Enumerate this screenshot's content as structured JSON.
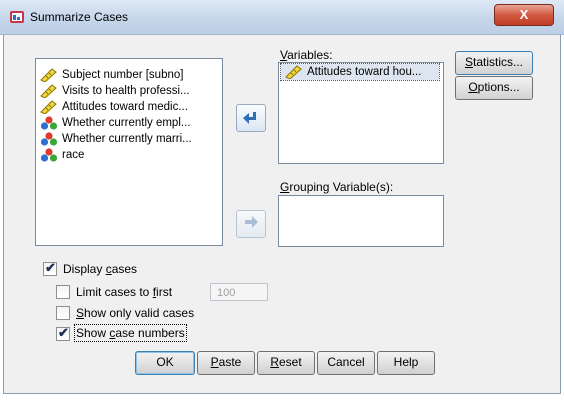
{
  "window": {
    "title": "Summarize Cases",
    "close_label": "X"
  },
  "source_list": {
    "items": [
      {
        "label": "Subject number [subno]",
        "icon": "ruler-icon"
      },
      {
        "label": "Visits to health professi...",
        "icon": "ruler-icon"
      },
      {
        "label": "Attitudes toward medic...",
        "icon": "ruler-icon"
      },
      {
        "label": "Whether currently empl...",
        "icon": "nominal-icon"
      },
      {
        "label": "Whether currently marri...",
        "icon": "nominal-icon"
      },
      {
        "label": "race",
        "icon": "nominal-icon"
      }
    ]
  },
  "variables": {
    "label_pre": "",
    "label_ul": "V",
    "label_post": "ariables:",
    "items": [
      {
        "label": "Attitudes toward hou...",
        "icon": "ruler-icon"
      }
    ]
  },
  "grouping": {
    "label_ul": "G",
    "label_post": "rouping Variable(s):"
  },
  "side_buttons": {
    "statistics": {
      "ul": "S",
      "rest": "tatistics..."
    },
    "options": {
      "ul": "O",
      "rest": "ptions..."
    }
  },
  "options": {
    "display_cases": {
      "pre": "Display ",
      "ul": "c",
      "post": "ases",
      "checked": true
    },
    "limit_cases": {
      "pre": "Limit cases to ",
      "ul": "f",
      "post": "irst",
      "checked": false,
      "value": "100"
    },
    "valid_only": {
      "pre": "",
      "ul": "S",
      "post": "how only valid cases",
      "checked": false
    },
    "case_numbers": {
      "pre": "Show ",
      "ul": "c",
      "post": "ase numbers",
      "checked": true
    }
  },
  "buttons": {
    "ok": "OK",
    "paste": {
      "ul": "P",
      "rest": "aste"
    },
    "reset": {
      "ul": "R",
      "rest": "eset"
    },
    "cancel": "Cancel",
    "help": "Help"
  },
  "colors": {
    "accent": "#3c7fb1",
    "arrow_active": "#2f6fb5",
    "arrow_disabled": "#a9bdd6"
  }
}
